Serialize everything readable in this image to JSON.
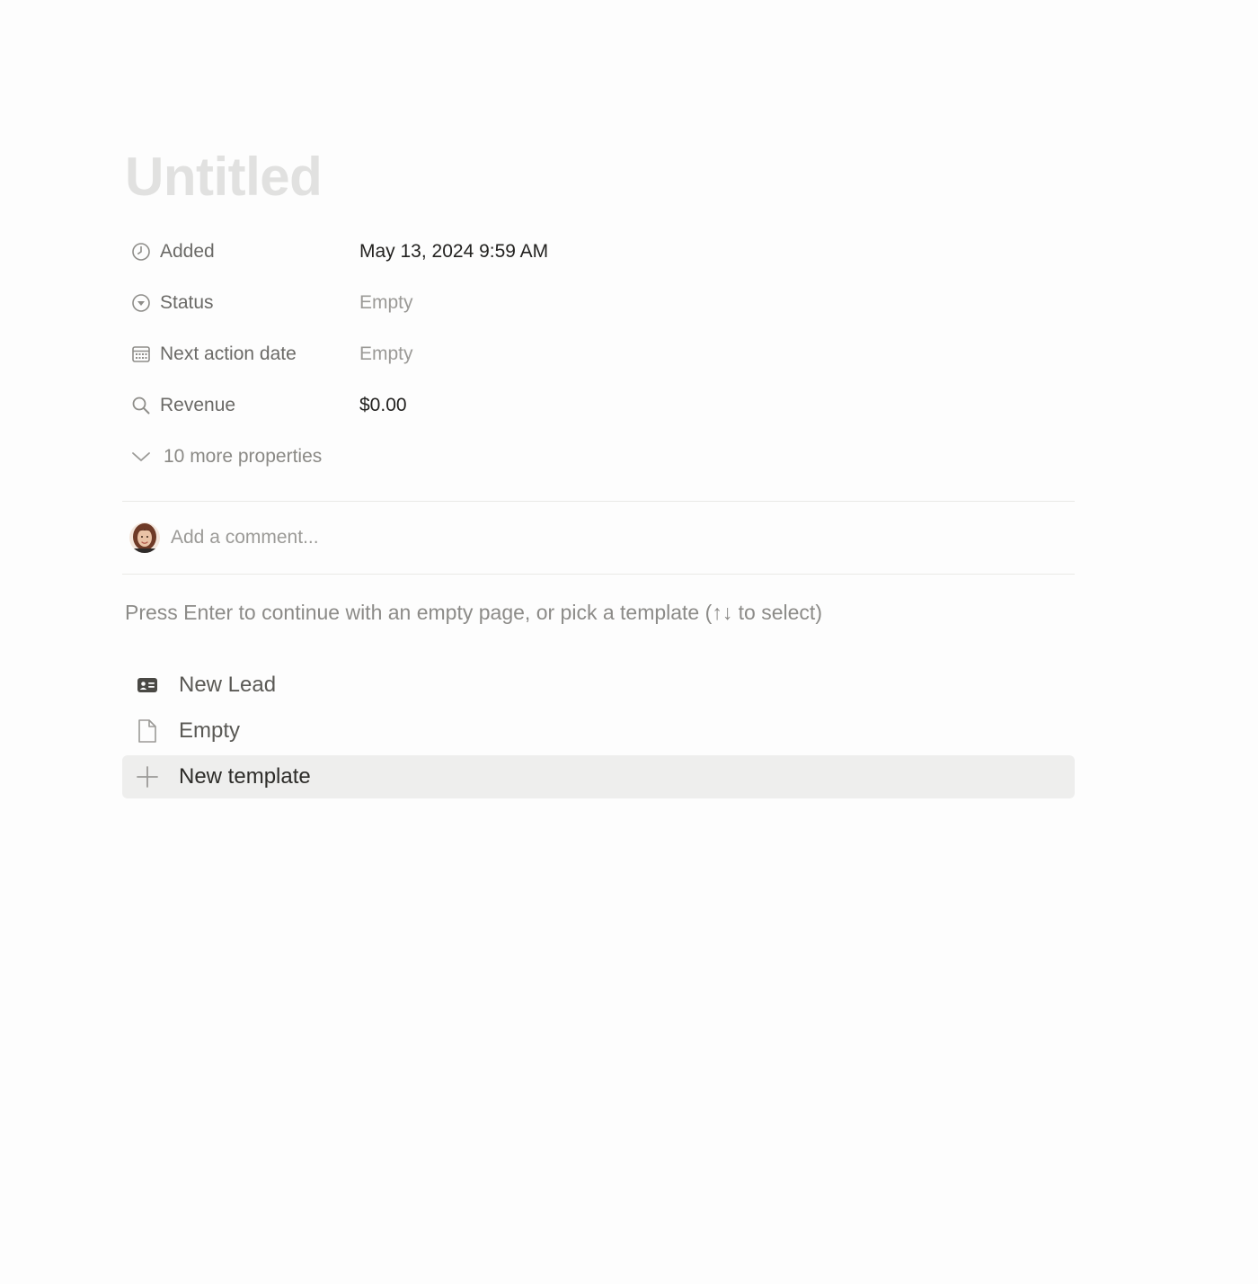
{
  "page": {
    "title_placeholder": "Untitled"
  },
  "properties": [
    {
      "name": "Added",
      "icon": "clock-icon",
      "value": "May 13, 2024 9:59 AM",
      "empty": false
    },
    {
      "name": "Status",
      "icon": "status-icon",
      "value": "Empty",
      "empty": true
    },
    {
      "name": "Next action date",
      "icon": "calendar-icon",
      "value": "Empty",
      "empty": true
    },
    {
      "name": "Revenue",
      "icon": "search-icon",
      "value": "$0.00",
      "empty": false
    }
  ],
  "more_properties": {
    "label": "10 more properties",
    "icon": "chevron-down-icon"
  },
  "comment": {
    "placeholder": "Add a comment..."
  },
  "template_hint": "Press Enter to continue with an empty page, or pick a template (↑↓ to select)",
  "templates": [
    {
      "label": "New Lead",
      "icon": "contact-card-icon",
      "selected": false
    },
    {
      "label": "Empty",
      "icon": "document-icon",
      "selected": false
    },
    {
      "label": "New template",
      "icon": "plus-icon",
      "selected": true
    }
  ],
  "colors": {
    "background": "#fdfdfd",
    "title_placeholder": "#e1e1e0",
    "muted_text": "#9b9a97",
    "selected_row": "#eeeeed"
  }
}
